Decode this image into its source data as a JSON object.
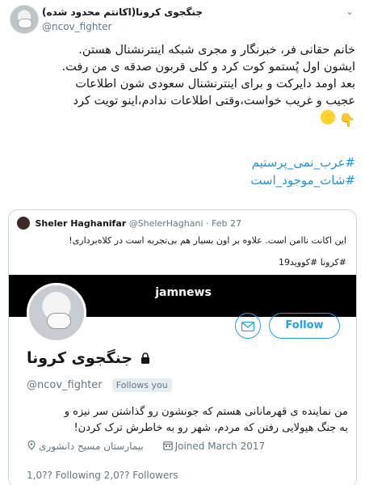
{
  "tweet": {
    "display_name": "جنگجوی کرونا(اکانتم محدود شده)",
    "handle": "@ncov_fighter",
    "lines": [
      "خانم حقانی فر، خبرنگار و مجری شبکه اینترنشنال هستن.",
      "ایشون اول پُستمو کوت کرد و کلی قربون صدقه ی من رفت.",
      "بعد اومد دایرکت و برای اینترنشنال سعودی شون اطلاعات",
      "عجیب و غریب خواست،وقتی اطلاعات ندادم،اینو تویت کرد"
    ],
    "emojis": [
      "hand-pointing-down-icon",
      "sweat-smile-icon"
    ],
    "hashtags": [
      "#عرب_نمی_پرستیم",
      "#شات_موجود_است"
    ]
  },
  "quote": {
    "name": "Sheler Haghanifar",
    "handle": "@ShelerHaghani",
    "date": "· Feb 27",
    "text": "این اکانت ناامن است. علاوه بر اون بسیار هم بی‌تجربه است در کلاه‌برداری!",
    "tags": "#کرونا #کووید19"
  },
  "profile": {
    "watermark": "jamnews",
    "follow_label": "Follow",
    "name": "جنگجوی کرونا",
    "handle": "@ncov_fighter",
    "follows_you": "Follows you",
    "bio_lines": [
      "من نماینده ی قهرمانانی هستم که جونشون رو گذاشتن سر نیزه و",
      "به جنگ هیولایی رفتن که مردم، شهر رو به خاطرش ترک کردن!"
    ],
    "location": "بیمارستان مسیح دانشوری",
    "joined": "Joined March 2017",
    "counts": "1,0?? Following   2,0?? Followers"
  },
  "colors": {
    "link": "#1b95e0",
    "accent": "#1da1f2",
    "muted": "#657786"
  }
}
